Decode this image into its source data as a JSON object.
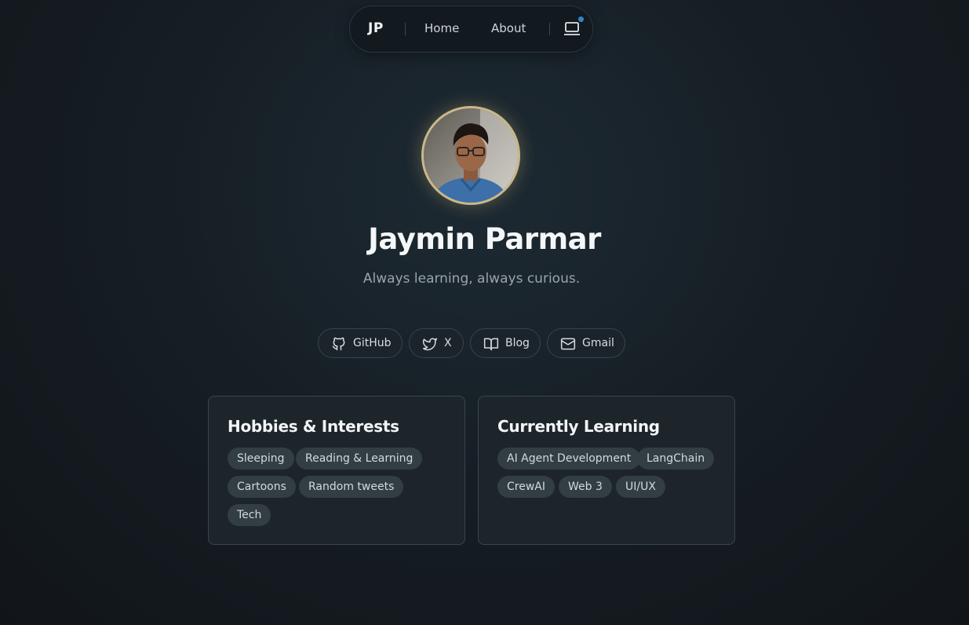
{
  "nav": {
    "logo": "JP",
    "links": [
      "Home",
      "About"
    ],
    "device_icon": "laptop-icon",
    "notification_color": "#2f86c9"
  },
  "profile": {
    "name": "Jaymin Parmar",
    "tagline": "Always learning, always curious.",
    "avatar_ring_color": "#c9b88a"
  },
  "social": [
    {
      "label": "GitHub",
      "icon": "github-icon"
    },
    {
      "label": "X",
      "icon": "twitter-icon"
    },
    {
      "label": "Blog",
      "icon": "book-icon"
    },
    {
      "label": "Gmail",
      "icon": "mail-icon"
    }
  ],
  "hobbies": {
    "title": "Hobbies & Interests",
    "items": [
      "Sleeping",
      "Reading & Learning",
      "Cartoons",
      "Random tweets",
      "Tech"
    ]
  },
  "learning": {
    "title": "Currently Learning",
    "items": [
      "AI Agent Development",
      "LangChain",
      "CrewAI",
      "Web 3",
      "UI/UX"
    ]
  }
}
